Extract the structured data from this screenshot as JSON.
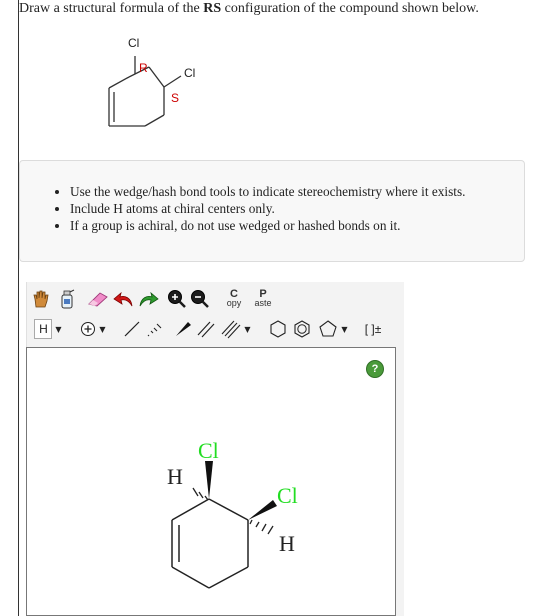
{
  "question": {
    "part1": "Draw a structural formula of the ",
    "bold": "RS",
    "part2": " configuration of the compound shown below."
  },
  "given_structure": {
    "atom_top": "Cl",
    "atom_right": "Cl",
    "label_r": "R",
    "label_s": "S"
  },
  "instructions": [
    "Use the wedge/hash bond tools to indicate stereochemistry where it exists.",
    "Include H atoms at chiral centers only.",
    "If a group is achiral, do not use wedged or hashed bonds on it."
  ],
  "toolbar": {
    "copy_big": "C",
    "copy_small": "opy",
    "paste_big": "P",
    "paste_small": "aste",
    "atom_button": "H",
    "bracket_label": "[ ]±"
  },
  "canvas": {
    "help_label": "?",
    "atom_cl_top": "Cl",
    "atom_cl_right": "Cl",
    "atom_h_left": "H",
    "atom_h_right": "H"
  },
  "colors": {
    "chlorine": "#22dd22",
    "r_label": "#cc0000",
    "s_label": "#cc0000",
    "help_bg": "#4a9a3a"
  }
}
